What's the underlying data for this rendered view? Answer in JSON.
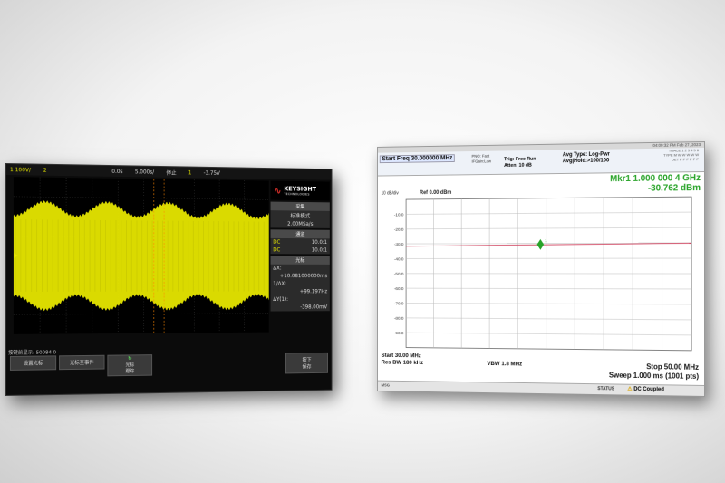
{
  "scope": {
    "top_bar": {
      "ch1": "1 100V/",
      "ch2": "2",
      "delay": "0.0s",
      "timebase": "5.000s/",
      "run_state": "停止",
      "trig_ch": "1",
      "trig_level": "-3.75V"
    },
    "brand": {
      "name": "KEYSIGHT",
      "sub": "TECHNOLOGIES"
    },
    "acquire": {
      "header": "采集",
      "mode": "标准模式",
      "rate": "2.00MSa/s"
    },
    "channels": {
      "header": "通道",
      "rows": [
        {
          "label": "DC",
          "value": "10.0:1"
        },
        {
          "label": "DC",
          "value": "10.0:1"
        }
      ]
    },
    "cursors": {
      "header": "光标",
      "dx_label": "ΔX:",
      "dx_value": "+10.081000000ms",
      "inv_label": "1/ΔX:",
      "inv_value": "+99.197Hz",
      "dy_label": "ΔY(1):",
      "dy_value": "-398.00mV"
    },
    "status": "按键前显示: 50084 0",
    "softkeys": [
      "设置光标",
      "光标至事件",
      "光标\n跟踪",
      "按下\n保存"
    ],
    "colors": {
      "waveform": "#e6e600",
      "background": "#000000"
    }
  },
  "analyzer": {
    "title_bar": {
      "left": "",
      "right": "04:09:32 PM Feb 27, 2023"
    },
    "start_freq": "Start Freq 30.000000 MHz",
    "pno": "PNO: Fast",
    "ifgain": "IFGain:Low",
    "trig": "Trig: Free Run",
    "atten": "Atten: 10 dB",
    "avg_type": "Avg Type: Log-Pwr",
    "avg_hold": "Avg|Hold:>100/100",
    "trace_info": {
      "trace": "TRACE 1 2 3 4 5 6",
      "type": "TYPE M W W W W W",
      "det": "DET P P P P P P"
    },
    "marker": {
      "label": "Mkr1 1.000 000 4 GHz",
      "value": "-30.762 dBm"
    },
    "ref": {
      "scale": "10 dB/div",
      "level": "Ref 0.00 dBm"
    },
    "y_ticks": [
      "-10.0",
      "-20.0",
      "-30.0",
      "-40.0",
      "-50.0",
      "-60.0",
      "-70.0",
      "-80.0",
      "-90.0"
    ],
    "marker_point": {
      "x_frac_of_span": 0.48,
      "level_dbm": -30.762
    },
    "footer": {
      "start": "Start 30.00 MHz",
      "rbw": "Res BW 180 kHz",
      "vbw": "VBW 1.8 MHz",
      "stop": "Stop 50.00 MHz",
      "sweep": "Sweep  1.000 ms (1001 pts)"
    },
    "status": {
      "msg": "MSG",
      "stat": "STATUS",
      "dc": "DC Coupled"
    },
    "colors": {
      "marker": "#27a327",
      "trace": "#d0435f"
    }
  }
}
